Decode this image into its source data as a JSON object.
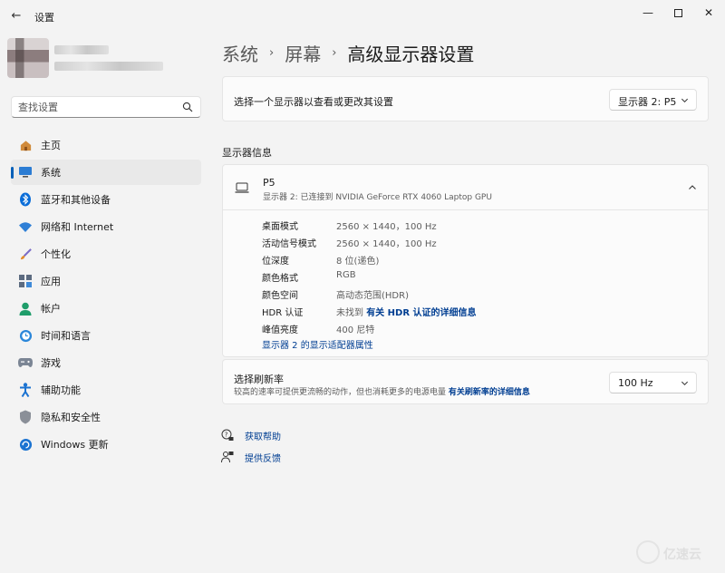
{
  "window": {
    "title": "设置",
    "back_glyph": "←",
    "min_glyph": "—",
    "close_glyph": "✕"
  },
  "search": {
    "placeholder": "查找设置"
  },
  "nav": [
    {
      "label": "主页",
      "icon": "home-icon"
    },
    {
      "label": "系统",
      "icon": "system-icon",
      "active": true
    },
    {
      "label": "蓝牙和其他设备",
      "icon": "bluetooth-icon"
    },
    {
      "label": "网络和 Internet",
      "icon": "wifi-icon"
    },
    {
      "label": "个性化",
      "icon": "brush-icon"
    },
    {
      "label": "应用",
      "icon": "apps-icon"
    },
    {
      "label": "帐户",
      "icon": "account-icon"
    },
    {
      "label": "时间和语言",
      "icon": "clock-globe-icon"
    },
    {
      "label": "游戏",
      "icon": "gamepad-icon"
    },
    {
      "label": "辅助功能",
      "icon": "accessibility-icon"
    },
    {
      "label": "隐私和安全性",
      "icon": "shield-icon"
    },
    {
      "label": "Windows 更新",
      "icon": "update-icon"
    }
  ],
  "breadcrumb": {
    "item1": "系统",
    "item2": "屏幕",
    "current": "高级显示器设置",
    "sep": "›"
  },
  "display_select": {
    "label": "选择一个显示器以查看或更改其设置",
    "value": "显示器 2: P5"
  },
  "section_title": "显示器信息",
  "monitor": {
    "name": "P5",
    "subtitle": "显示器 2: 已连接到 NVIDIA GeForce RTX 4060 Laptop GPU",
    "rows": [
      {
        "key": "桌面模式",
        "value": "2560 × 1440，100 Hz"
      },
      {
        "key": "活动信号模式",
        "value": "2560 × 1440，100 Hz"
      },
      {
        "key": "位深度",
        "value": "8 位(递色)"
      },
      {
        "key": "颜色格式",
        "value": "RGB"
      },
      {
        "key": "颜色空间",
        "value": "高动态范围(HDR)"
      },
      {
        "key": "HDR 认证",
        "value": "未找到",
        "link": "有关 HDR 认证的详细信息"
      },
      {
        "key": "峰值亮度",
        "value": "400 尼特"
      }
    ],
    "adapter_link": "显示器 2 的显示适配器属性"
  },
  "refresh": {
    "title": "选择刷新率",
    "desc": "较高的速率可提供更流畅的动作，但也消耗更多的电源电量",
    "link": "有关刷新率的详细信息",
    "value": "100 Hz"
  },
  "help": {
    "get_help": "获取帮助",
    "feedback": "提供反馈"
  },
  "watermark": {
    "text": "亿速云"
  },
  "colors": {
    "accent": "#005fb8",
    "link": "#003e92",
    "background": "#f3f3f3",
    "card": "#fbfbfb"
  }
}
